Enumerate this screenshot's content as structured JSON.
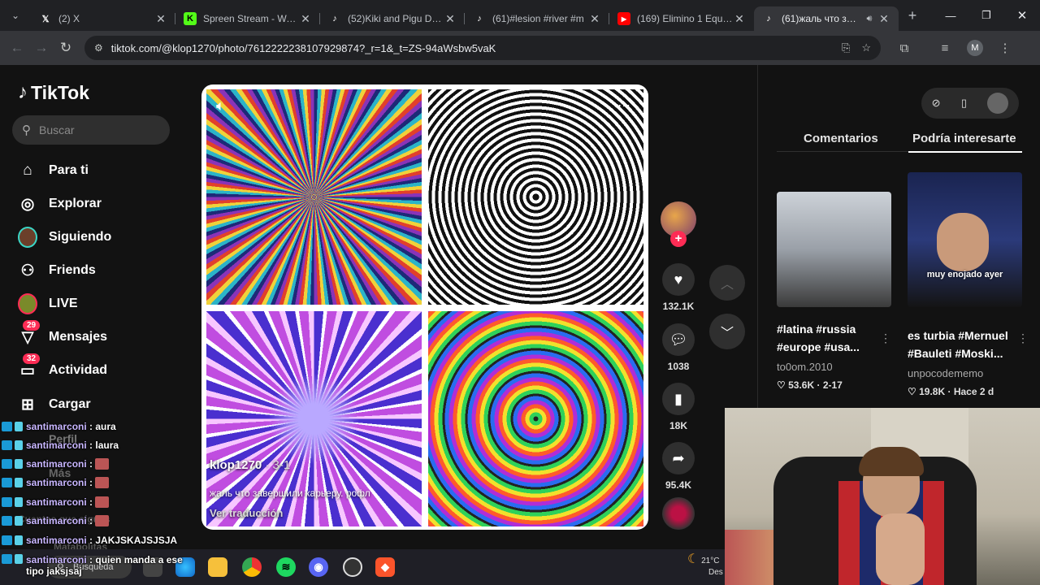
{
  "browser": {
    "tabs": [
      {
        "title": "(2) X",
        "icon": "x-logo-icon",
        "active": false
      },
      {
        "title": "Spreen Stream - Watch",
        "icon": "kick-logo-icon",
        "active": false
      },
      {
        "title": "(52)Kiki and Pigu Dance",
        "icon": "tiktok-logo-icon",
        "active": false
      },
      {
        "title": "(61)#lesion #river #m",
        "icon": "tiktok-logo-icon",
        "active": false
      },
      {
        "title": "(169) Elimino 1 Equipo",
        "icon": "youtube-logo-icon",
        "active": false
      },
      {
        "title": "(61)жаль что заве",
        "icon": "tiktok-logo-icon",
        "active": true
      }
    ],
    "new_tab": "+",
    "url": "tiktok.com/@klop1270/photo/7612222238107929874?_r=1&_t=ZS-94aWsbw5vaK",
    "profile_initial": "M"
  },
  "tiktok": {
    "logo": "TikTok",
    "search_placeholder": "Buscar",
    "nav": [
      {
        "label": "Para ti",
        "icon": "home-icon"
      },
      {
        "label": "Explorar",
        "icon": "compass-icon"
      },
      {
        "label": "Siguiendo",
        "icon": "following-avatar-icon"
      },
      {
        "label": "Friends",
        "icon": "friends-icon"
      },
      {
        "label": "LIVE",
        "icon": "live-icon"
      },
      {
        "label": "Mensajes",
        "icon": "messages-icon",
        "badge": "29"
      },
      {
        "label": "Actividad",
        "icon": "activity-icon",
        "badge": "32"
      },
      {
        "label": "Cargar",
        "icon": "upload-icon"
      }
    ],
    "nav_hidden": [
      "Perfil",
      "Más",
      "Cuentas que sigues",
      "Matabolitas"
    ],
    "post": {
      "username": "klop1270",
      "date": "· 3-1",
      "caption": "жаль что завершили карьеру. рофл",
      "translate": "Ver traducción"
    },
    "actions": {
      "likes": "132.1K",
      "comments": "1038",
      "saves": "18K",
      "shares": "95.4K"
    },
    "right_tabs": {
      "comments": "Comentarios",
      "suggested": "Podría interesarte"
    },
    "suggested": [
      {
        "title": "#latina #russia #europe #usa...",
        "user": "to0om.2010",
        "likes": "53.6K",
        "date": "2-17"
      },
      {
        "title": "es turbia #Mernuel #Bauleti #Moski...",
        "user": "unpocodememo",
        "likes": "19.8K",
        "date": "Hace 2 d",
        "overlay": "muy enojado ayer"
      }
    ]
  },
  "chat": [
    {
      "user": "santimarconi",
      "msg": ": aura"
    },
    {
      "user": "santimarconi",
      "msg": ": laura"
    },
    {
      "user": "santimarconi",
      "msg": ":"
    },
    {
      "user": "santimarconi",
      "msg": ":"
    },
    {
      "user": "santimarconi",
      "msg": ":"
    },
    {
      "user": "santimarconi",
      "msg": ":"
    },
    {
      "user": "santimarconi",
      "msg": ": JAKJSKAJSJSJA"
    },
    {
      "user": "santimarconi",
      "msg": ": quien manda a ese tipo jaksjsaj"
    }
  ],
  "taskbar": {
    "search": "Búsqueda",
    "weather_temp": "21°C",
    "weather_text": "Des"
  },
  "colors": {
    "accent": "#fe2c55",
    "background": "#121212"
  }
}
